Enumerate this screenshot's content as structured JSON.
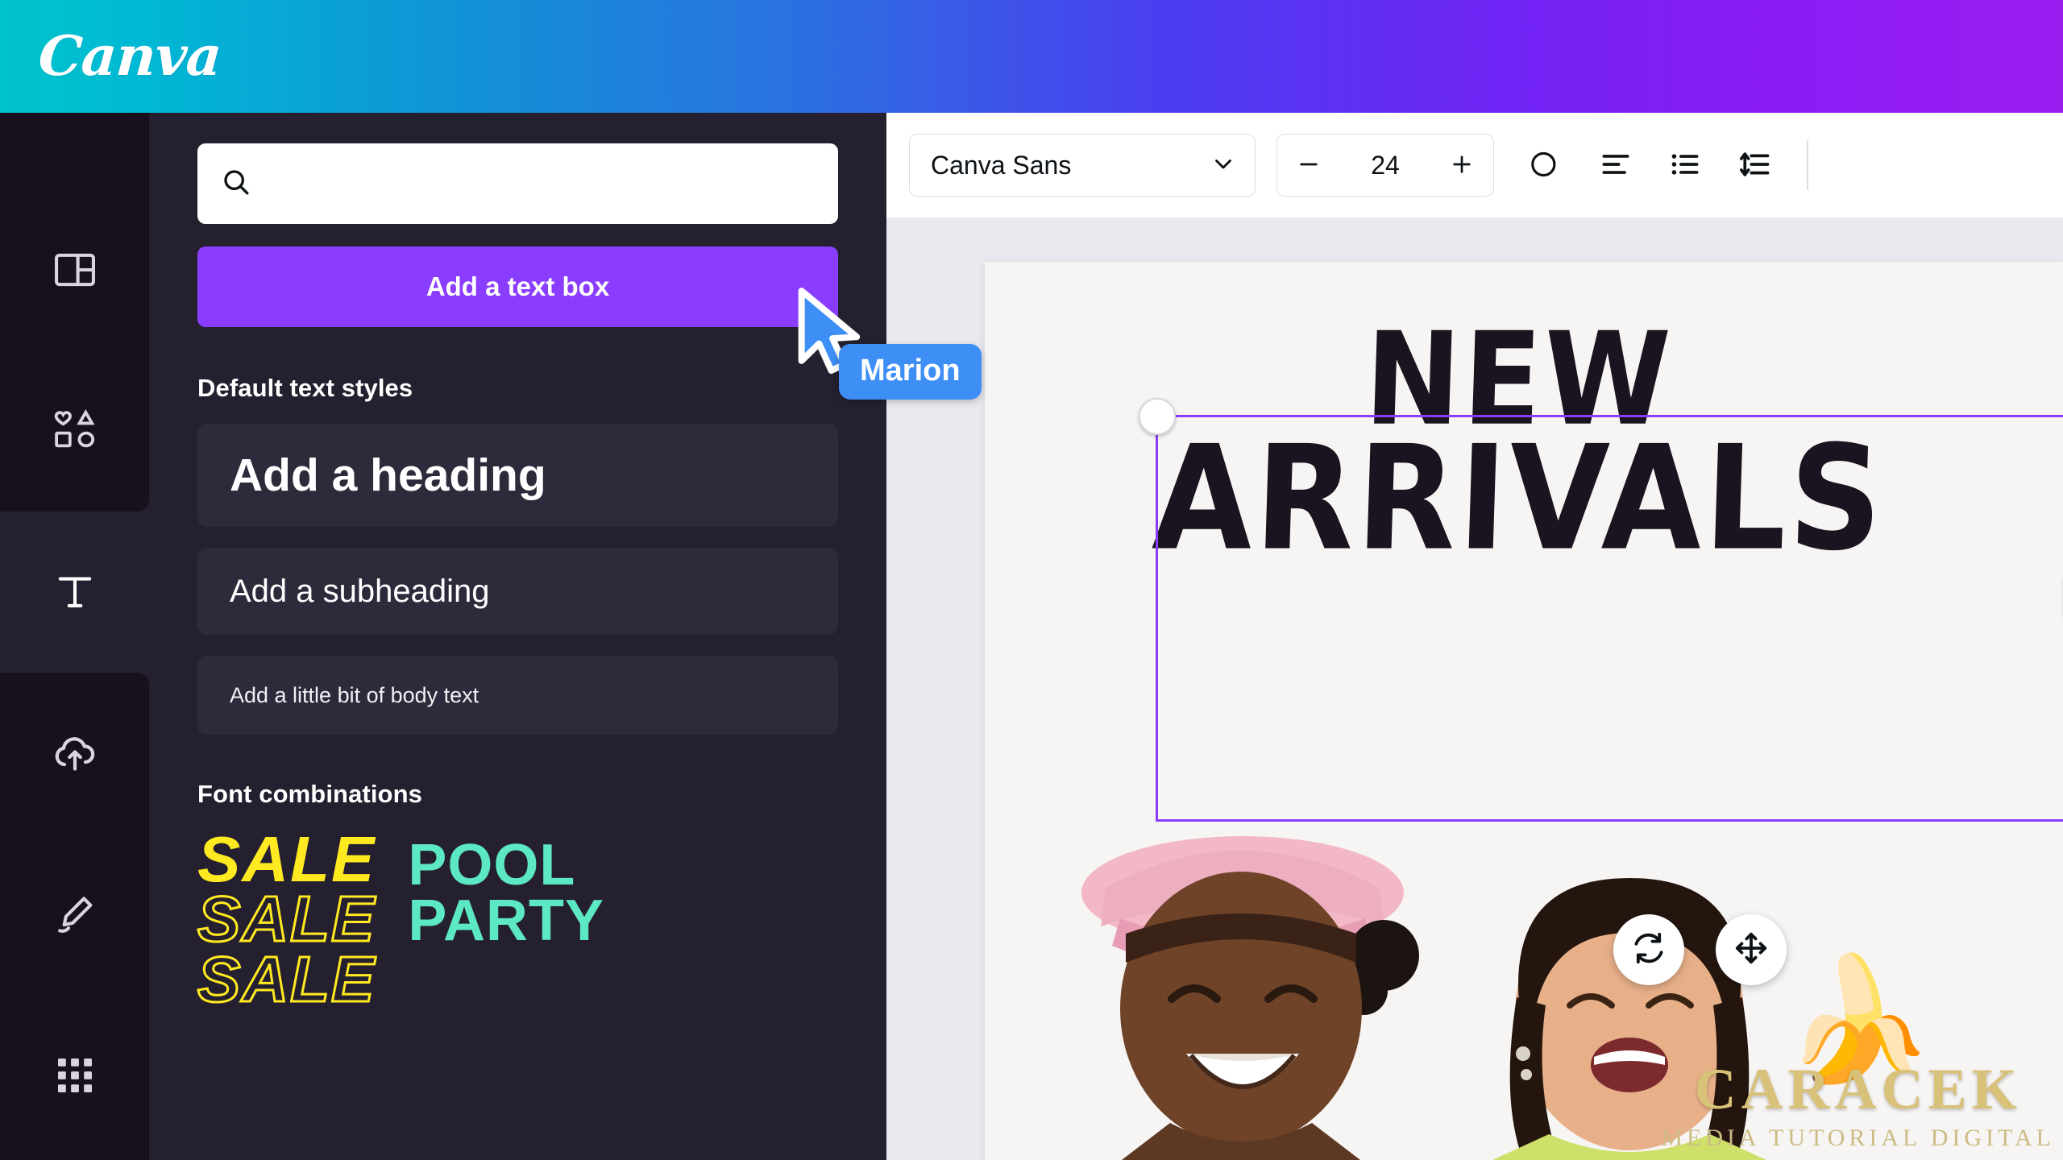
{
  "brand": {
    "logo_text": "Canva",
    "accent_purple": "#8b3dff",
    "gradient_start": "#00c4cc",
    "gradient_end": "#9a1df0"
  },
  "rail": {
    "items": [
      {
        "name": "design",
        "icon": "layout-icon",
        "active": false
      },
      {
        "name": "elements",
        "icon": "shapes-icon",
        "active": false
      },
      {
        "name": "text",
        "icon": "text-t-icon",
        "active": true
      },
      {
        "name": "uploads",
        "icon": "cloud-upload-icon",
        "active": false
      },
      {
        "name": "draw",
        "icon": "pen-draw-icon",
        "active": false
      },
      {
        "name": "apps",
        "icon": "grid-apps-icon",
        "active": false
      }
    ]
  },
  "panel": {
    "search": {
      "placeholder": "",
      "value": "",
      "icon": "search-icon"
    },
    "add_text_box_label": "Add a text box",
    "default_styles_title": "Default text styles",
    "styles": [
      {
        "label": "Add a heading"
      },
      {
        "label": "Add a subheading"
      },
      {
        "label": "Add a little bit of body text"
      }
    ],
    "font_combinations_title": "Font combinations",
    "combinations": [
      {
        "lines": [
          "SALE",
          "SALE",
          "SALE"
        ],
        "color": "#ffe920"
      },
      {
        "lines": [
          "POOL",
          "PARTY"
        ],
        "color": "#5de8c4"
      }
    ]
  },
  "toolbar": {
    "font_name": "Canva Sans",
    "font_size": "24",
    "decrease_label": "−",
    "increase_label": "+",
    "chevron_icon": "chevron-down-icon",
    "effects_icon": "text-effects-icon",
    "align_icon": "align-left-icon",
    "list_icon": "bullet-list-icon",
    "spacing_icon": "line-spacing-icon"
  },
  "canvas": {
    "headline_line1": "NEW",
    "headline_line2": "ARRIVALS",
    "selection_color": "#8b3dff",
    "rotate_icon": "rotate-icon",
    "move_icon": "move-icon"
  },
  "collaborator": {
    "name": "Marion",
    "cursor_color": "#3d8ef5"
  },
  "watermark": {
    "emoji": "🍌",
    "title": "CARACEK",
    "subtitle": "MEDIA TUTORIAL DIGITAL"
  }
}
